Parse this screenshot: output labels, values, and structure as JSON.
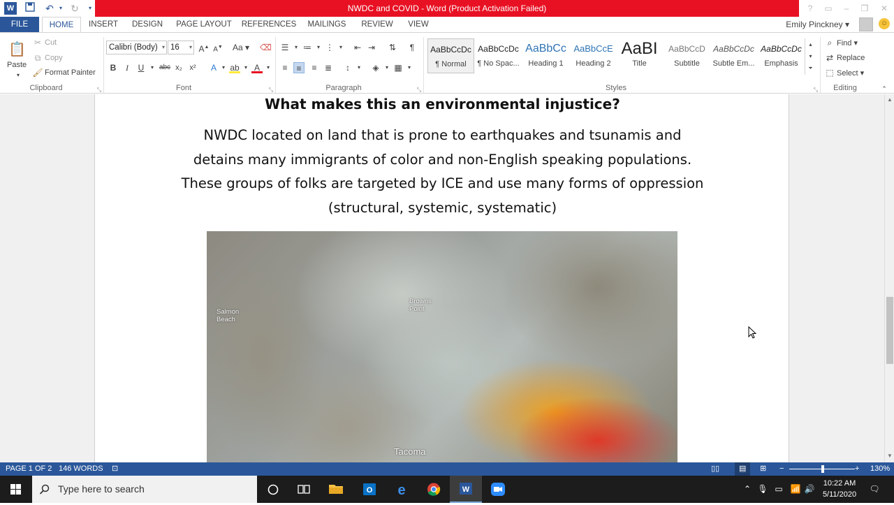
{
  "window": {
    "title": "NWDC and COVID  -  Word (Product Activation Failed)",
    "user": "Emily Pinckney"
  },
  "ribbon": {
    "tabs": [
      "FILE",
      "HOME",
      "INSERT",
      "DESIGN",
      "PAGE LAYOUT",
      "REFERENCES",
      "MAILINGS",
      "REVIEW",
      "VIEW"
    ],
    "active_tab": "HOME",
    "clipboard": {
      "paste": "Paste",
      "cut": "Cut",
      "copy": "Copy",
      "format_painter": "Format Painter",
      "label": "Clipboard"
    },
    "font": {
      "name": "Calibri (Body)",
      "size": "16",
      "label": "Font"
    },
    "paragraph": {
      "label": "Paragraph"
    },
    "styles": {
      "label": "Styles",
      "items": [
        {
          "sample": "AaBbCcDc",
          "name": "¶ Normal"
        },
        {
          "sample": "AaBbCcDc",
          "name": "¶ No Spac..."
        },
        {
          "sample": "AaBbCc",
          "name": "Heading 1"
        },
        {
          "sample": "AaBbCcE",
          "name": "Heading 2"
        },
        {
          "sample": "AaBI",
          "name": "Title"
        },
        {
          "sample": "AaBbCcD",
          "name": "Subtitle"
        },
        {
          "sample": "AaBbCcDc",
          "name": "Subtle Em..."
        },
        {
          "sample": "AaBbCcDc",
          "name": "Emphasis"
        }
      ]
    },
    "editing": {
      "find": "Find",
      "replace": "Replace",
      "select": "Select",
      "label": "Editing"
    }
  },
  "document": {
    "heading": "What makes this an environmental injustice?",
    "body": "NWDC located on land that is prone to earthquakes and tsunamis and detains many immigrants of color and non-English speaking populations. These groups of folks are targeted by ICE and use many forms of oppression (structural, systemic, systematic)",
    "image_labels": {
      "salmon_beach": "Salmon\nBeach",
      "browns_point": "Browns\nPoint",
      "tacoma": "Tacoma"
    }
  },
  "statusbar": {
    "page": "PAGE 1 OF 2",
    "words": "146 WORDS",
    "zoom": "130%",
    "zoom_level": 1.3
  },
  "taskbar": {
    "search_placeholder": "Type here to search",
    "time": "10:22 AM",
    "date": "5/11/2020"
  },
  "colors": {
    "word_blue": "#2b579a",
    "activation_red": "#e81123",
    "taskbar": "#1c1c1c"
  }
}
